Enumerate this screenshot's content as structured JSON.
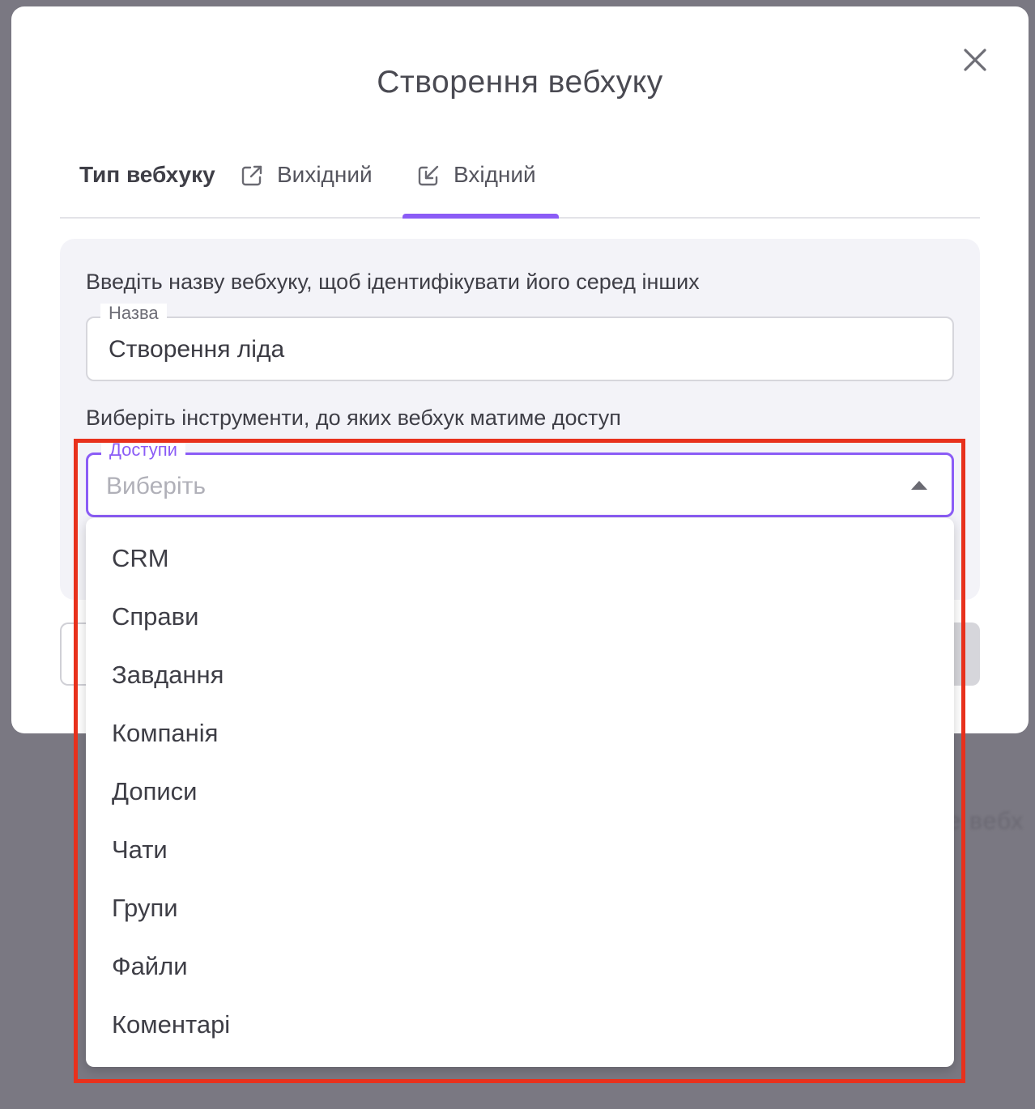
{
  "background": {
    "ghost_text": "е вебх"
  },
  "modal": {
    "title": "Створення вебхуку",
    "close_icon": "close-icon"
  },
  "tabs": {
    "label": "Тип вебхуку",
    "items": [
      {
        "label": "Вихідний",
        "icon": "external-link-icon",
        "selected": false
      },
      {
        "label": "Вхідний",
        "icon": "incoming-arrow-icon",
        "selected": true
      }
    ]
  },
  "form": {
    "name_hint": "Введіть назву вебхуку, щоб ідентифікувати його серед інших",
    "name_field": {
      "label": "Назва",
      "value": "Створення ліда"
    },
    "access_hint": "Виберіть інструменти, до яких вебхук матиме доступ",
    "access_field": {
      "label": "Доступи",
      "placeholder": "Виберіть",
      "open": true
    }
  },
  "dropdown": {
    "options": [
      "CRM",
      "Справи",
      "Завдання",
      "Компанія",
      "Дописи",
      "Чати",
      "Групи",
      "Файли",
      "Коментарі"
    ]
  },
  "colors": {
    "accent": "#8b5cf6",
    "highlight": "#e8311c",
    "overlay": "#7a7882"
  }
}
